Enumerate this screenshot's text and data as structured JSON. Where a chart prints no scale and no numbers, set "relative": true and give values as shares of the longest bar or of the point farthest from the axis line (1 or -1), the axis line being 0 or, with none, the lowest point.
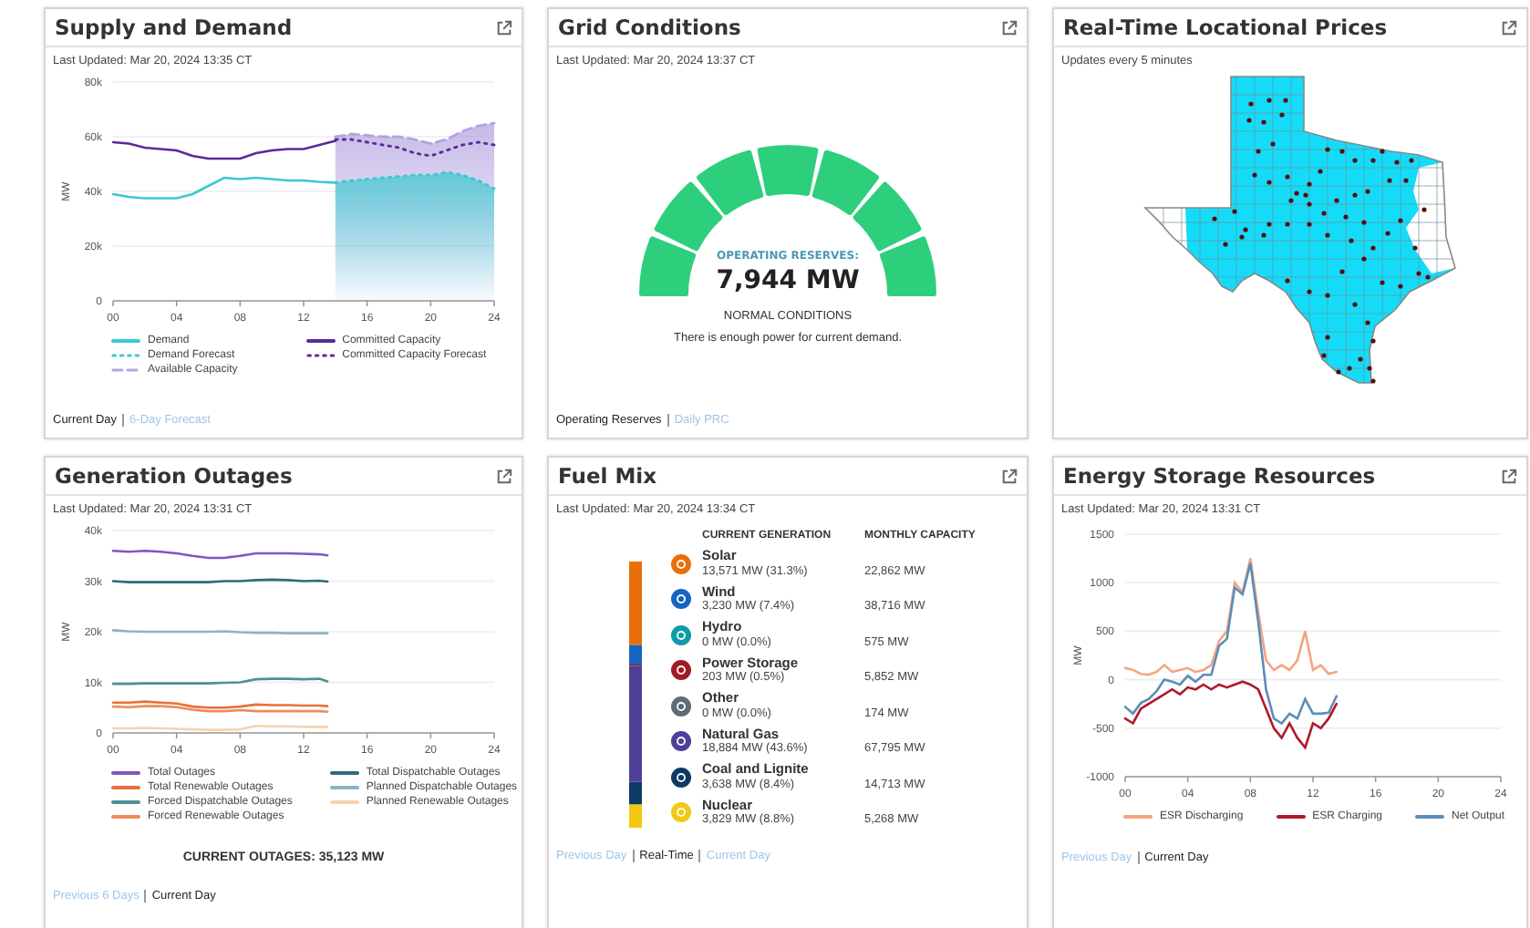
{
  "supply_demand": {
    "title": "Supply and Demand",
    "last_updated": "Last Updated: Mar 20, 2024 13:35 CT",
    "chart_data": {
      "type": "line",
      "ylabel": "MW",
      "grid": true,
      "x": [
        0,
        1,
        2,
        3,
        4,
        5,
        6,
        7,
        8,
        9,
        10,
        11,
        12,
        13,
        14,
        15,
        16,
        17,
        18,
        19,
        20,
        21,
        22,
        23,
        24
      ],
      "xlim": [
        0,
        24
      ],
      "ylim": [
        0,
        80000
      ],
      "xticks": [
        {
          "value": 0,
          "label": "00"
        },
        {
          "value": 4,
          "label": "04"
        },
        {
          "value": 8,
          "label": "08"
        },
        {
          "value": 12,
          "label": "12"
        },
        {
          "value": 16,
          "label": "16"
        },
        {
          "value": 20,
          "label": "20"
        },
        {
          "value": 24,
          "label": "24"
        }
      ],
      "yticks": [
        {
          "value": 0,
          "label": "0"
        },
        {
          "value": 20000,
          "label": "20k"
        },
        {
          "value": 40000,
          "label": "40k"
        },
        {
          "value": 60000,
          "label": "60k"
        },
        {
          "value": 80000,
          "label": "80k"
        }
      ],
      "series": [
        {
          "name": "Demand",
          "color": "#3cc8d0",
          "type": "line",
          "line_style": "solid",
          "values": [
            39000,
            38000,
            37500,
            37500,
            37500,
            39000,
            42000,
            45000,
            44500,
            45000,
            44500,
            44000,
            44000,
            43500,
            43200,
            null,
            null,
            null,
            null,
            null,
            null,
            null,
            null,
            null,
            null
          ]
        },
        {
          "name": "Committed Capacity",
          "color": "#5b2a9c",
          "type": "line",
          "line_style": "solid",
          "values": [
            58000,
            57500,
            56000,
            55500,
            55000,
            53000,
            52000,
            52000,
            52000,
            54000,
            55000,
            55500,
            55500,
            57000,
            58500,
            null,
            null,
            null,
            null,
            null,
            null,
            null,
            null,
            null,
            null
          ]
        },
        {
          "name": "Demand Forecast",
          "color": "#3cc8d0",
          "type": "area",
          "line_style": "dotted",
          "values": [
            null,
            null,
            null,
            null,
            null,
            null,
            null,
            null,
            null,
            null,
            null,
            null,
            null,
            null,
            43200,
            44000,
            44500,
            45000,
            45500,
            46000,
            46000,
            47000,
            46000,
            44000,
            41000
          ]
        },
        {
          "name": "Committed Capacity Forecast",
          "color": "#5b2a9c",
          "type": "line",
          "line_style": "dotted",
          "values": [
            null,
            null,
            null,
            null,
            null,
            null,
            null,
            null,
            null,
            null,
            null,
            null,
            null,
            null,
            59000,
            59000,
            58000,
            57000,
            56000,
            54000,
            53000,
            55000,
            57000,
            58000,
            57000
          ]
        },
        {
          "name": "Available Capacity",
          "color": "#b3a3e0",
          "type": "area",
          "line_style": "dashed",
          "values": [
            null,
            null,
            null,
            null,
            null,
            null,
            null,
            null,
            null,
            null,
            null,
            null,
            null,
            null,
            60000,
            61000,
            60500,
            60000,
            60000,
            59000,
            57500,
            59000,
            62000,
            64000,
            65000
          ]
        }
      ]
    },
    "links": [
      {
        "label": "Current Day",
        "selected": true
      },
      {
        "label": "6-Day Forecast",
        "selected": false
      }
    ]
  },
  "grid_conditions": {
    "title": "Grid Conditions",
    "last_updated": "Last Updated: Mar 20, 2024 13:37 CT",
    "reserves_label": "OPERATING RESERVES:",
    "reserves_value": "7,944 MW",
    "status": "NORMAL CONDITIONS",
    "message": "There is enough power for current demand.",
    "links": [
      {
        "label": "Operating Reserves",
        "selected": true
      },
      {
        "label": "Daily PRC",
        "selected": false
      }
    ]
  },
  "locational_prices": {
    "title": "Real-Time Locational Prices",
    "subtitle": "Updates every 5 minutes"
  },
  "generation_outages": {
    "title": "Generation Outages",
    "last_updated": "Last Updated: Mar 20, 2024 13:31 CT",
    "chart_data": {
      "type": "line",
      "ylabel": "MW",
      "grid": true,
      "x": [
        0,
        1,
        2,
        3,
        4,
        5,
        6,
        7,
        8,
        9,
        10,
        11,
        12,
        13,
        13.5
      ],
      "xlim": [
        0,
        24
      ],
      "ylim": [
        0,
        40000
      ],
      "xticks": [
        {
          "value": 0,
          "label": "00"
        },
        {
          "value": 4,
          "label": "04"
        },
        {
          "value": 8,
          "label": "08"
        },
        {
          "value": 12,
          "label": "12"
        },
        {
          "value": 16,
          "label": "16"
        },
        {
          "value": 20,
          "label": "20"
        },
        {
          "value": 24,
          "label": "24"
        }
      ],
      "yticks": [
        {
          "value": 0,
          "label": "0"
        },
        {
          "value": 10000,
          "label": "10k"
        },
        {
          "value": 20000,
          "label": "20k"
        },
        {
          "value": 30000,
          "label": "30k"
        },
        {
          "value": 40000,
          "label": "40k"
        }
      ],
      "series": [
        {
          "name": "Total Outages",
          "color": "#7e57c2",
          "values": [
            36000,
            35800,
            36000,
            35800,
            35500,
            35000,
            34600,
            34600,
            35000,
            35500,
            35500,
            35500,
            35400,
            35300,
            35100
          ]
        },
        {
          "name": "Total Dispatchable Outages",
          "color": "#2a6f7a",
          "values": [
            30000,
            29800,
            29800,
            29800,
            29800,
            29800,
            29800,
            30000,
            30000,
            30200,
            30300,
            30200,
            30000,
            30100,
            29900
          ]
        },
        {
          "name": "Total Renewable Outages",
          "color": "#e8703a",
          "values": [
            6000,
            6000,
            6200,
            6000,
            5800,
            5200,
            5000,
            5000,
            5200,
            5600,
            5500,
            5500,
            5400,
            5400,
            5300
          ]
        },
        {
          "name": "Planned Dispatchable Outages",
          "color": "#8fb3c4",
          "values": [
            20300,
            20100,
            20000,
            20000,
            20000,
            20000,
            20000,
            20100,
            19900,
            19800,
            19800,
            19700,
            19700,
            19700,
            19700
          ]
        },
        {
          "name": "Forced Dispatchable Outages",
          "color": "#4f9098",
          "values": [
            9700,
            9700,
            9800,
            9800,
            9800,
            9800,
            9800,
            9900,
            10000,
            10600,
            10700,
            10700,
            10600,
            10700,
            10200
          ]
        },
        {
          "name": "Planned Renewable Outages",
          "color": "#f8d2b0",
          "values": [
            900,
            900,
            1000,
            900,
            800,
            700,
            600,
            600,
            700,
            1400,
            1300,
            1300,
            1200,
            1200,
            1200
          ]
        },
        {
          "name": "Forced Renewable Outages",
          "color": "#ef8a5a",
          "values": [
            5200,
            5100,
            5300,
            5300,
            5100,
            4600,
            4300,
            4300,
            4500,
            4300,
            4300,
            4300,
            4300,
            4300,
            4200
          ]
        }
      ]
    },
    "current_outages": "CURRENT OUTAGES: 35,123 MW",
    "links": [
      {
        "label": "Previous 6 Days",
        "selected": false
      },
      {
        "label": "Current Day",
        "selected": true
      }
    ]
  },
  "fuel_mix": {
    "title": "Fuel Mix",
    "last_updated": "Last Updated: Mar 20, 2024 13:34 CT",
    "headers": [
      "CURRENT GENERATION",
      "MONTHLY CAPACITY"
    ],
    "chart_data": {
      "type": "bar",
      "stacked": true,
      "relative": true,
      "orientation": "vertical",
      "series": [
        {
          "name": "Nuclear",
          "color": "#f2c811",
          "values": [
            0.088
          ]
        },
        {
          "name": "Coal and Lignite",
          "color": "#0d3b66",
          "values": [
            0.084
          ]
        },
        {
          "name": "Natural Gas",
          "color": "#4f3f98",
          "values": [
            0.436
          ]
        },
        {
          "name": "Other",
          "color": "#5f6b75",
          "values": [
            0.0
          ]
        },
        {
          "name": "Power Storage",
          "color": "#a01c25",
          "values": [
            0.005
          ]
        },
        {
          "name": "Hydro",
          "color": "#0e9aa7",
          "values": [
            0.0
          ]
        },
        {
          "name": "Wind",
          "color": "#1565c0",
          "values": [
            0.074
          ]
        },
        {
          "name": "Solar",
          "color": "#e8700a",
          "values": [
            0.313
          ]
        }
      ]
    },
    "sources": [
      {
        "current": "13,571 MW (31.3%)",
        "capacity": "22,862 MW"
      },
      {
        "current": "3,230 MW (7.4%)",
        "capacity": "38,716 MW"
      },
      {
        "current": "0 MW (0.0%)",
        "capacity": "575 MW"
      },
      {
        "current": "203 MW (0.5%)",
        "capacity": "5,852 MW"
      },
      {
        "current": "0 MW (0.0%)",
        "capacity": "174 MW"
      },
      {
        "current": "18,884 MW (43.6%)",
        "capacity": "67,795 MW"
      },
      {
        "current": "3,638 MW (8.4%)",
        "capacity": "14,713 MW"
      },
      {
        "current": "3,829 MW (8.8%)",
        "capacity": "5,268 MW"
      }
    ],
    "links": [
      {
        "label": "Previous Day",
        "selected": false
      },
      {
        "label": "Real-Time",
        "selected": true
      },
      {
        "label": "Current Day",
        "selected": false
      }
    ]
  },
  "energy_storage": {
    "title": "Energy Storage Resources",
    "last_updated": "Last Updated: Mar 20, 2024 13:31 CT",
    "chart_data": {
      "type": "line",
      "ylabel": "MW",
      "grid": true,
      "x": [
        0,
        0.5,
        1,
        1.5,
        2,
        2.5,
        3,
        3.5,
        4,
        4.5,
        5,
        5.5,
        6,
        6.5,
        7,
        7.5,
        8,
        8.5,
        9,
        9.5,
        10,
        10.5,
        11,
        11.5,
        12,
        12.5,
        13,
        13.5
      ],
      "xlim": [
        0,
        24
      ],
      "ylim": [
        -1000,
        1500
      ],
      "xticks": [
        {
          "value": 0,
          "label": "00"
        },
        {
          "value": 4,
          "label": "04"
        },
        {
          "value": 8,
          "label": "08"
        },
        {
          "value": 12,
          "label": "12"
        },
        {
          "value": 16,
          "label": "16"
        },
        {
          "value": 20,
          "label": "20"
        },
        {
          "value": 24,
          "label": "24"
        }
      ],
      "yticks": [
        -1000,
        -500,
        0,
        500,
        1000,
        1500
      ],
      "series": [
        {
          "name": "ESR Discharging",
          "color": "#f4a582",
          "values": [
            120,
            100,
            60,
            50,
            80,
            150,
            80,
            100,
            120,
            80,
            100,
            150,
            400,
            500,
            1000,
            900,
            1250,
            700,
            200,
            100,
            150,
            100,
            200,
            500,
            100,
            150,
            60,
            80
          ]
        },
        {
          "name": "ESR Charging",
          "color": "#b2182b",
          "values": [
            -400,
            -450,
            -300,
            -250,
            -200,
            -150,
            -100,
            -150,
            -80,
            -100,
            -50,
            -100,
            -50,
            -80,
            -50,
            -20,
            -50,
            -100,
            -300,
            -500,
            -600,
            -450,
            -600,
            -700,
            -450,
            -500,
            -400,
            -250
          ]
        },
        {
          "name": "Net Output",
          "color": "#5b8db8",
          "values": [
            -280,
            -350,
            -240,
            -200,
            -120,
            0,
            -20,
            -50,
            40,
            -20,
            50,
            50,
            350,
            420,
            950,
            880,
            1200,
            600,
            -100,
            -400,
            -450,
            -350,
            -400,
            -200,
            -350,
            -350,
            -340,
            -170
          ]
        }
      ]
    },
    "links": [
      {
        "label": "Previous Day",
        "selected": false
      },
      {
        "label": "Current Day",
        "selected": true
      }
    ]
  }
}
